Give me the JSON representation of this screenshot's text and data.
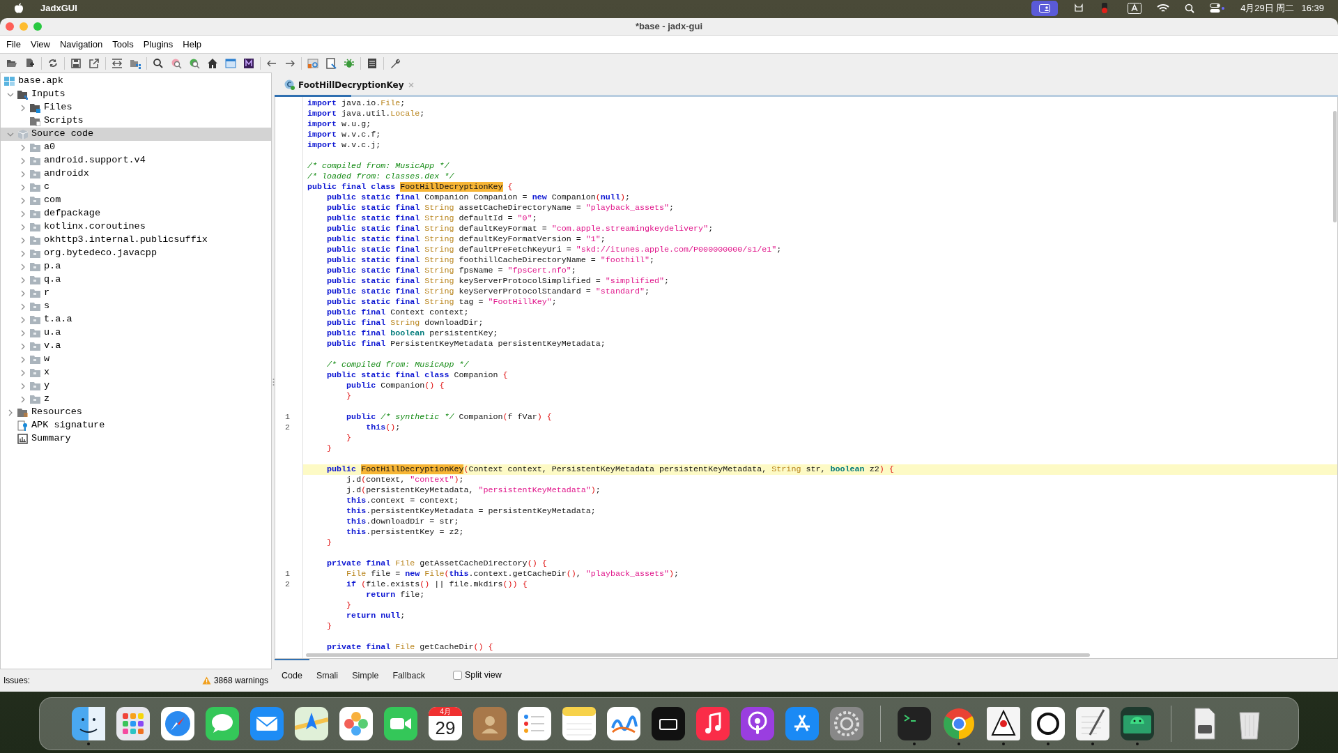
{
  "menubar": {
    "app": "JadxGUI",
    "date": "4月29日 周二",
    "time": "16:39"
  },
  "window": {
    "title": "*base - jadx-gui"
  },
  "menu": [
    "File",
    "View",
    "Navigation",
    "Tools",
    "Plugins",
    "Help"
  ],
  "tree": [
    {
      "label": "base.apk",
      "kind": "apk",
      "selected": false,
      "children": [
        {
          "label": "Inputs",
          "kind": "inputs",
          "expanded": true,
          "selected": false,
          "children": [
            {
              "label": "Files",
              "kind": "files",
              "expanded": false,
              "selected": false
            },
            {
              "label": "Scripts",
              "kind": "scripts",
              "selected": false
            }
          ]
        },
        {
          "label": "Source code",
          "kind": "source",
          "expanded": true,
          "selected": true,
          "children": [
            {
              "label": "a0",
              "kind": "package",
              "expanded": false,
              "selected": false
            },
            {
              "label": "android.support.v4",
              "kind": "package",
              "expanded": false,
              "selected": false
            },
            {
              "label": "androidx",
              "kind": "package",
              "expanded": false,
              "selected": false
            },
            {
              "label": "c",
              "kind": "package",
              "expanded": false,
              "selected": false
            },
            {
              "label": "com",
              "kind": "package",
              "expanded": false,
              "selected": false
            },
            {
              "label": "defpackage",
              "kind": "package",
              "expanded": false,
              "selected": false
            },
            {
              "label": "kotlinx.coroutines",
              "kind": "package",
              "expanded": false,
              "selected": false
            },
            {
              "label": "okhttp3.internal.publicsuffix",
              "kind": "package",
              "expanded": false,
              "selected": false
            },
            {
              "label": "org.bytedeco.javacpp",
              "kind": "package",
              "expanded": false,
              "selected": false
            },
            {
              "label": "p.a",
              "kind": "package",
              "expanded": false,
              "selected": false
            },
            {
              "label": "q.a",
              "kind": "package",
              "expanded": false,
              "selected": false
            },
            {
              "label": "r",
              "kind": "package",
              "expanded": false,
              "selected": false
            },
            {
              "label": "s",
              "kind": "package",
              "expanded": false,
              "selected": false
            },
            {
              "label": "t.a.a",
              "kind": "package",
              "expanded": false,
              "selected": false
            },
            {
              "label": "u.a",
              "kind": "package",
              "expanded": false,
              "selected": false
            },
            {
              "label": "v.a",
              "kind": "package",
              "expanded": false,
              "selected": false
            },
            {
              "label": "w",
              "kind": "package",
              "expanded": false,
              "selected": false
            },
            {
              "label": "x",
              "kind": "package",
              "expanded": false,
              "selected": false
            },
            {
              "label": "y",
              "kind": "package",
              "expanded": false,
              "selected": false
            },
            {
              "label": "z",
              "kind": "package",
              "expanded": false,
              "selected": false
            }
          ]
        },
        {
          "label": "Resources",
          "kind": "resources",
          "expanded": false,
          "selected": false
        },
        {
          "label": "APK signature",
          "kind": "signature",
          "selected": false
        },
        {
          "label": "Summary",
          "kind": "summary",
          "selected": false
        }
      ]
    }
  ],
  "issues": {
    "label": "Issues:",
    "warnings": "3868 warnings"
  },
  "editor_tabs": [
    {
      "label": "FootHillDecryptionKey",
      "selected": true
    }
  ],
  "code": [
    {
      "kind": "code",
      "tokens": [
        {
          "kind": "keyword",
          "text": "import "
        },
        {
          "kind": "plain",
          "text": "java.io."
        },
        {
          "kind": "type",
          "text": "File"
        },
        {
          "kind": "plain",
          "text": ";"
        }
      ]
    },
    {
      "kind": "code",
      "tokens": [
        {
          "kind": "keyword",
          "text": "import "
        },
        {
          "kind": "plain",
          "text": "java.util."
        },
        {
          "kind": "type",
          "text": "Locale"
        },
        {
          "kind": "plain",
          "text": ";"
        }
      ]
    },
    {
      "kind": "code",
      "tokens": [
        {
          "kind": "keyword",
          "text": "import "
        },
        {
          "kind": "plain",
          "text": "w.u.g;"
        }
      ]
    },
    {
      "kind": "code",
      "tokens": [
        {
          "kind": "keyword",
          "text": "import "
        },
        {
          "kind": "plain",
          "text": "w.v.c.f;"
        }
      ]
    },
    {
      "kind": "code",
      "tokens": [
        {
          "kind": "keyword",
          "text": "import "
        },
        {
          "kind": "plain",
          "text": "w.v.c.j;"
        }
      ]
    },
    {
      "kind": "blank"
    },
    {
      "kind": "code",
      "tokens": [
        {
          "kind": "comment",
          "text": "/* compiled from: MusicApp */"
        }
      ]
    },
    {
      "kind": "code",
      "tokens": [
        {
          "kind": "comment",
          "text": "/* loaded from: classes.dex */"
        }
      ]
    },
    {
      "kind": "code",
      "tokens": [
        {
          "kind": "keyword",
          "text": "public final class "
        },
        {
          "kind": "match",
          "text": "FootHillDecryptionKey"
        },
        {
          "kind": "punct",
          "text": " {"
        }
      ]
    },
    {
      "kind": "code",
      "tokens": [
        {
          "kind": "keyword",
          "text": "    public static final "
        },
        {
          "kind": "plain",
          "text": "Companion Companion = "
        },
        {
          "kind": "keyword",
          "text": "new "
        },
        {
          "kind": "plain",
          "text": "Companion"
        },
        {
          "kind": "punct",
          "text": "("
        },
        {
          "kind": "keyword",
          "text": "null"
        },
        {
          "kind": "punct",
          "text": ")"
        },
        {
          "kind": "plain",
          "text": ";"
        }
      ]
    },
    {
      "kind": "code",
      "tokens": [
        {
          "kind": "keyword",
          "text": "    public static final "
        },
        {
          "kind": "type",
          "text": "String "
        },
        {
          "kind": "plain",
          "text": "assetCacheDirectoryName = "
        },
        {
          "kind": "string",
          "text": "\"playback_assets\""
        },
        {
          "kind": "plain",
          "text": ";"
        }
      ]
    },
    {
      "kind": "code",
      "tokens": [
        {
          "kind": "keyword",
          "text": "    public static final "
        },
        {
          "kind": "type",
          "text": "String "
        },
        {
          "kind": "plain",
          "text": "defaultId = "
        },
        {
          "kind": "string",
          "text": "\"0\""
        },
        {
          "kind": "plain",
          "text": ";"
        }
      ]
    },
    {
      "kind": "code",
      "tokens": [
        {
          "kind": "keyword",
          "text": "    public static final "
        },
        {
          "kind": "type",
          "text": "String "
        },
        {
          "kind": "plain",
          "text": "defaultKeyFormat = "
        },
        {
          "kind": "string",
          "text": "\"com.apple.streamingkeydelivery\""
        },
        {
          "kind": "plain",
          "text": ";"
        }
      ]
    },
    {
      "kind": "code",
      "tokens": [
        {
          "kind": "keyword",
          "text": "    public static final "
        },
        {
          "kind": "type",
          "text": "String "
        },
        {
          "kind": "plain",
          "text": "defaultKeyFormatVersion = "
        },
        {
          "kind": "string",
          "text": "\"1\""
        },
        {
          "kind": "plain",
          "text": ";"
        }
      ]
    },
    {
      "kind": "code",
      "tokens": [
        {
          "kind": "keyword",
          "text": "    public static final "
        },
        {
          "kind": "type",
          "text": "String "
        },
        {
          "kind": "plain",
          "text": "defaultPreFetchKeyUri = "
        },
        {
          "kind": "string",
          "text": "\"skd://itunes.apple.com/P000000000/s1/e1\""
        },
        {
          "kind": "plain",
          "text": ";"
        }
      ]
    },
    {
      "kind": "code",
      "tokens": [
        {
          "kind": "keyword",
          "text": "    public static final "
        },
        {
          "kind": "type",
          "text": "String "
        },
        {
          "kind": "plain",
          "text": "foothillCacheDirectoryName = "
        },
        {
          "kind": "string",
          "text": "\"foothill\""
        },
        {
          "kind": "plain",
          "text": ";"
        }
      ]
    },
    {
      "kind": "code",
      "tokens": [
        {
          "kind": "keyword",
          "text": "    public static final "
        },
        {
          "kind": "type",
          "text": "String "
        },
        {
          "kind": "plain",
          "text": "fpsName = "
        },
        {
          "kind": "string",
          "text": "\"fpsCert.nfo\""
        },
        {
          "kind": "plain",
          "text": ";"
        }
      ]
    },
    {
      "kind": "code",
      "tokens": [
        {
          "kind": "keyword",
          "text": "    public static final "
        },
        {
          "kind": "type",
          "text": "String "
        },
        {
          "kind": "plain",
          "text": "keyServerProtocolSimplified = "
        },
        {
          "kind": "string",
          "text": "\"simplified\""
        },
        {
          "kind": "plain",
          "text": ";"
        }
      ]
    },
    {
      "kind": "code",
      "tokens": [
        {
          "kind": "keyword",
          "text": "    public static final "
        },
        {
          "kind": "type",
          "text": "String "
        },
        {
          "kind": "plain",
          "text": "keyServerProtocolStandard = "
        },
        {
          "kind": "string",
          "text": "\"standard\""
        },
        {
          "kind": "plain",
          "text": ";"
        }
      ]
    },
    {
      "kind": "code",
      "tokens": [
        {
          "kind": "keyword",
          "text": "    public static final "
        },
        {
          "kind": "type",
          "text": "String "
        },
        {
          "kind": "plain",
          "text": "tag = "
        },
        {
          "kind": "string",
          "text": "\"FootHillKey\""
        },
        {
          "kind": "plain",
          "text": ";"
        }
      ]
    },
    {
      "kind": "code",
      "tokens": [
        {
          "kind": "keyword",
          "text": "    public final "
        },
        {
          "kind": "plain",
          "text": "Context context;"
        }
      ]
    },
    {
      "kind": "code",
      "tokens": [
        {
          "kind": "keyword",
          "text": "    public final "
        },
        {
          "kind": "type",
          "text": "String "
        },
        {
          "kind": "plain",
          "text": "downloadDir;"
        }
      ]
    },
    {
      "kind": "code",
      "tokens": [
        {
          "kind": "keyword",
          "text": "    public final "
        },
        {
          "kind": "primitive",
          "text": "boolean "
        },
        {
          "kind": "plain",
          "text": "persistentKey;"
        }
      ]
    },
    {
      "kind": "code",
      "tokens": [
        {
          "kind": "keyword",
          "text": "    public final "
        },
        {
          "kind": "plain",
          "text": "PersistentKeyMetadata persistentKeyMetadata;"
        }
      ]
    },
    {
      "kind": "blank"
    },
    {
      "kind": "code",
      "tokens": [
        {
          "kind": "comment",
          "text": "    /* compiled from: MusicApp */"
        }
      ]
    },
    {
      "kind": "code",
      "tokens": [
        {
          "kind": "keyword",
          "text": "    public static final class "
        },
        {
          "kind": "plain",
          "text": "Companion "
        },
        {
          "kind": "punct",
          "text": "{"
        }
      ]
    },
    {
      "kind": "code",
      "tokens": [
        {
          "kind": "keyword",
          "text": "        public "
        },
        {
          "kind": "plain",
          "text": "Companion"
        },
        {
          "kind": "punct",
          "text": "() {"
        }
      ]
    },
    {
      "kind": "code",
      "tokens": [
        {
          "kind": "punct",
          "text": "        }"
        }
      ]
    },
    {
      "kind": "blank"
    },
    {
      "kind": "code",
      "gutter": "1",
      "tokens": [
        {
          "kind": "keyword",
          "text": "        public "
        },
        {
          "kind": "comment",
          "text": "/* synthetic */ "
        },
        {
          "kind": "plain",
          "text": "Companion"
        },
        {
          "kind": "punct",
          "text": "("
        },
        {
          "kind": "plain",
          "text": "f fVar"
        },
        {
          "kind": "punct",
          "text": ") {"
        }
      ]
    },
    {
      "kind": "code",
      "gutter": "2",
      "tokens": [
        {
          "kind": "keyword",
          "text": "            this"
        },
        {
          "kind": "punct",
          "text": "()"
        },
        {
          "kind": "plain",
          "text": ";"
        }
      ]
    },
    {
      "kind": "code",
      "tokens": [
        {
          "kind": "punct",
          "text": "        }"
        }
      ]
    },
    {
      "kind": "code",
      "tokens": [
        {
          "kind": "punct",
          "text": "    }"
        }
      ]
    },
    {
      "kind": "blank"
    },
    {
      "kind": "code",
      "highlighted": true,
      "tokens": [
        {
          "kind": "keyword",
          "text": "    public "
        },
        {
          "kind": "match",
          "text": "FootHillDecryptionKey"
        },
        {
          "kind": "punct",
          "text": "("
        },
        {
          "kind": "plain",
          "text": "Context context, PersistentKeyMetadata persistentKeyMetadata, "
        },
        {
          "kind": "type",
          "text": "String "
        },
        {
          "kind": "plain",
          "text": "str, "
        },
        {
          "kind": "primitive",
          "text": "boolean "
        },
        {
          "kind": "plain",
          "text": "z2"
        },
        {
          "kind": "punct",
          "text": ") {"
        }
      ]
    },
    {
      "kind": "code",
      "tokens": [
        {
          "kind": "plain",
          "text": "        j.d"
        },
        {
          "kind": "punct",
          "text": "("
        },
        {
          "kind": "plain",
          "text": "context, "
        },
        {
          "kind": "string",
          "text": "\"context\""
        },
        {
          "kind": "punct",
          "text": ")"
        },
        {
          "kind": "plain",
          "text": ";"
        }
      ]
    },
    {
      "kind": "code",
      "tokens": [
        {
          "kind": "plain",
          "text": "        j.d"
        },
        {
          "kind": "punct",
          "text": "("
        },
        {
          "kind": "plain",
          "text": "persistentKeyMetadata, "
        },
        {
          "kind": "string",
          "text": "\"persistentKeyMetadata\""
        },
        {
          "kind": "punct",
          "text": ")"
        },
        {
          "kind": "plain",
          "text": ";"
        }
      ]
    },
    {
      "kind": "code",
      "tokens": [
        {
          "kind": "keyword",
          "text": "        this"
        },
        {
          "kind": "plain",
          "text": ".context = context;"
        }
      ]
    },
    {
      "kind": "code",
      "tokens": [
        {
          "kind": "keyword",
          "text": "        this"
        },
        {
          "kind": "plain",
          "text": ".persistentKeyMetadata = persistentKeyMetadata;"
        }
      ]
    },
    {
      "kind": "code",
      "tokens": [
        {
          "kind": "keyword",
          "text": "        this"
        },
        {
          "kind": "plain",
          "text": ".downloadDir = str;"
        }
      ]
    },
    {
      "kind": "code",
      "tokens": [
        {
          "kind": "keyword",
          "text": "        this"
        },
        {
          "kind": "plain",
          "text": ".persistentKey = z2;"
        }
      ]
    },
    {
      "kind": "code",
      "tokens": [
        {
          "kind": "punct",
          "text": "    }"
        }
      ]
    },
    {
      "kind": "blank"
    },
    {
      "kind": "code",
      "tokens": [
        {
          "kind": "keyword",
          "text": "    private final "
        },
        {
          "kind": "type",
          "text": "File "
        },
        {
          "kind": "plain",
          "text": "getAssetCacheDirectory"
        },
        {
          "kind": "punct",
          "text": "() {"
        }
      ]
    },
    {
      "kind": "code",
      "gutter": "1",
      "tokens": [
        {
          "kind": "type",
          "text": "        File "
        },
        {
          "kind": "plain",
          "text": "file = "
        },
        {
          "kind": "keyword",
          "text": "new "
        },
        {
          "kind": "type",
          "text": "File"
        },
        {
          "kind": "punct",
          "text": "("
        },
        {
          "kind": "keyword",
          "text": "this"
        },
        {
          "kind": "plain",
          "text": ".context.getCacheDir"
        },
        {
          "kind": "punct",
          "text": "()"
        },
        {
          "kind": "plain",
          "text": ", "
        },
        {
          "kind": "string",
          "text": "\"playback_assets\""
        },
        {
          "kind": "punct",
          "text": ")"
        },
        {
          "kind": "plain",
          "text": ";"
        }
      ]
    },
    {
      "kind": "code",
      "gutter": "2",
      "tokens": [
        {
          "kind": "keyword",
          "text": "        if "
        },
        {
          "kind": "punct",
          "text": "("
        },
        {
          "kind": "plain",
          "text": "file.exists"
        },
        {
          "kind": "punct",
          "text": "()"
        },
        {
          "kind": "plain",
          "text": " || file.mkdirs"
        },
        {
          "kind": "punct",
          "text": "()) {"
        }
      ]
    },
    {
      "kind": "code",
      "tokens": [
        {
          "kind": "keyword",
          "text": "            return "
        },
        {
          "kind": "plain",
          "text": "file;"
        }
      ]
    },
    {
      "kind": "code",
      "tokens": [
        {
          "kind": "punct",
          "text": "        }"
        }
      ]
    },
    {
      "kind": "code",
      "tokens": [
        {
          "kind": "keyword",
          "text": "        return null"
        },
        {
          "kind": "plain",
          "text": ";"
        }
      ]
    },
    {
      "kind": "code",
      "tokens": [
        {
          "kind": "punct",
          "text": "    }"
        }
      ]
    },
    {
      "kind": "blank"
    },
    {
      "kind": "code",
      "tokens": [
        {
          "kind": "keyword",
          "text": "    private final "
        },
        {
          "kind": "type",
          "text": "File "
        },
        {
          "kind": "plain",
          "text": "getCacheDir"
        },
        {
          "kind": "punct",
          "text": "() {"
        }
      ]
    }
  ],
  "bottom_tabs": [
    {
      "label": "Code",
      "selected": true
    },
    {
      "label": "Smali",
      "selected": false
    },
    {
      "label": "Simple",
      "selected": false
    },
    {
      "label": "Fallback",
      "selected": false
    }
  ],
  "split_view": {
    "label": "Split view",
    "checked": false
  },
  "dock": [
    {
      "kind": "finder",
      "running": true
    },
    {
      "kind": "launchpad",
      "running": false
    },
    {
      "kind": "safari",
      "running": false
    },
    {
      "kind": "messages",
      "running": false
    },
    {
      "kind": "mail",
      "running": false
    },
    {
      "kind": "maps",
      "running": false
    },
    {
      "kind": "photos",
      "running": false
    },
    {
      "kind": "facetime",
      "running": false
    },
    {
      "kind": "calendar",
      "running": false,
      "month": "4月",
      "day": "29"
    },
    {
      "kind": "contacts",
      "running": false
    },
    {
      "kind": "reminders",
      "running": false
    },
    {
      "kind": "notes",
      "running": false
    },
    {
      "kind": "freeform",
      "running": false
    },
    {
      "kind": "tv",
      "running": false
    },
    {
      "kind": "music",
      "running": false
    },
    {
      "kind": "podcasts",
      "running": false
    },
    {
      "kind": "appstore",
      "running": false
    },
    {
      "kind": "settings",
      "running": false
    },
    {
      "kind": "divider"
    },
    {
      "kind": "terminal",
      "running": true
    },
    {
      "kind": "chrome",
      "running": true
    },
    {
      "kind": "jadx",
      "running": true
    },
    {
      "kind": "ring",
      "running": true
    },
    {
      "kind": "textedit",
      "running": true
    },
    {
      "kind": "androidstudio",
      "running": true
    },
    {
      "kind": "divider"
    },
    {
      "kind": "document",
      "running": false
    },
    {
      "kind": "trash",
      "running": false
    }
  ]
}
